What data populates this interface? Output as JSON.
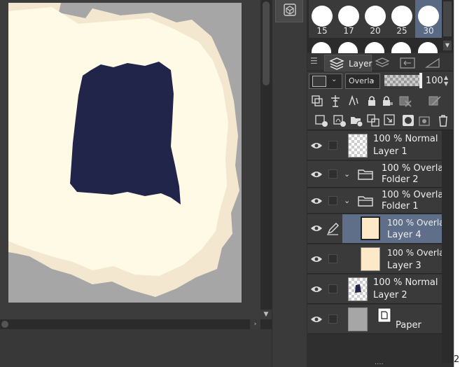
{
  "brush_sizes": {
    "row1": [
      "15",
      "17",
      "20",
      "25",
      "30"
    ],
    "selected": "30"
  },
  "panel": {
    "tab_label": "Layer",
    "blend_mode": "Overla",
    "opacity": "100"
  },
  "layers": [
    {
      "percent": "100 %",
      "mode": "Normal",
      "name": "Layer 1"
    },
    {
      "percent": "100 %",
      "mode": "Overlay",
      "name": "Folder 2"
    },
    {
      "percent": "100 %",
      "mode": "Overlay",
      "name": "Folder 1"
    },
    {
      "percent": "100 %",
      "mode": "Overlay",
      "name": "Layer 4"
    },
    {
      "percent": "100 %",
      "mode": "Overlay",
      "name": "Layer 3"
    },
    {
      "percent": "100 %",
      "mode": "Normal",
      "name": "Layer 2"
    },
    {
      "name": "Paper"
    }
  ],
  "footer": {
    "dots": "....",
    "edge_digit": "2"
  },
  "colors": {
    "stroke": "#22254a",
    "paint": "#fffbe9",
    "selection": "#5f6f8a"
  }
}
